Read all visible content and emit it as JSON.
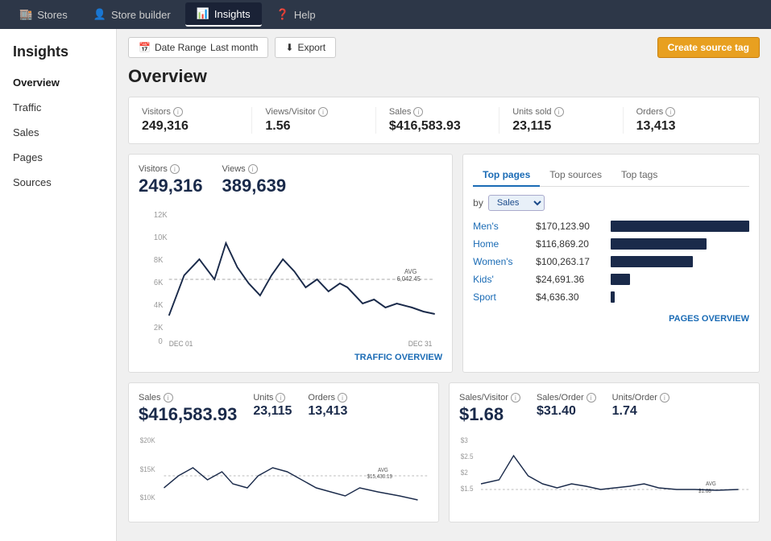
{
  "topnav": {
    "items": [
      {
        "id": "stores",
        "label": "Stores",
        "icon": "🏬",
        "active": false
      },
      {
        "id": "store-builder",
        "label": "Store builder",
        "icon": "👤",
        "active": false
      },
      {
        "id": "insights",
        "label": "Insights",
        "icon": "📊",
        "active": true
      },
      {
        "id": "help",
        "label": "Help",
        "icon": "❓",
        "active": false
      }
    ]
  },
  "sidebar": {
    "title": "Insights",
    "items": [
      {
        "id": "overview",
        "label": "Overview",
        "active": true
      },
      {
        "id": "traffic",
        "label": "Traffic",
        "active": false
      },
      {
        "id": "sales",
        "label": "Sales",
        "active": false
      },
      {
        "id": "pages",
        "label": "Pages",
        "active": false
      },
      {
        "id": "sources",
        "label": "Sources",
        "active": false
      }
    ]
  },
  "toolbar": {
    "date_range_label": "Date Range",
    "date_range_value": "Last month",
    "export_label": "Export",
    "create_source_tag_label": "Create source tag"
  },
  "overview": {
    "title": "Overview",
    "stats": [
      {
        "id": "visitors",
        "label": "Visitors",
        "value": "249,316"
      },
      {
        "id": "views-visitor",
        "label": "Views/Visitor",
        "value": "1.56"
      },
      {
        "id": "sales",
        "label": "Sales",
        "value": "$416,583.93"
      },
      {
        "id": "units-sold",
        "label": "Units sold",
        "value": "23,115"
      },
      {
        "id": "orders",
        "label": "Orders",
        "value": "13,413"
      }
    ]
  },
  "visitors_chart": {
    "visitors_label": "Visitors",
    "visitors_value": "249,316",
    "views_label": "Views",
    "views_value": "389,639",
    "avg_label": "AVG",
    "avg_value": "6,042.45",
    "x_start": "DEC 01",
    "x_end": "DEC 31",
    "link": "TRAFFIC OVERVIEW"
  },
  "top_pages": {
    "tabs": [
      "Top pages",
      "Top sources",
      "Top tags"
    ],
    "active_tab": "Top pages",
    "by_label": "by",
    "by_value": "Sales",
    "link": "PAGES OVERVIEW",
    "items": [
      {
        "name": "Men's",
        "value": "$170,123.90",
        "pct": 100
      },
      {
        "name": "Home",
        "value": "$116,869.20",
        "pct": 69
      },
      {
        "name": "Women's",
        "value": "$100,263.17",
        "pct": 59
      },
      {
        "name": "Kids'",
        "value": "$24,691.36",
        "pct": 14
      },
      {
        "name": "Sport",
        "value": "$4,636.30",
        "pct": 3
      }
    ]
  },
  "sales_chart": {
    "sales_label": "Sales",
    "sales_value": "$416,583.93",
    "units_label": "Units",
    "units_value": "23,115",
    "orders_label": "Orders",
    "orders_value": "13,413",
    "avg_label": "AVG",
    "avg_value": "$15,430.19",
    "y_labels": [
      "$20K",
      "$15K",
      "$10K"
    ]
  },
  "ratio_chart": {
    "sales_visitor_label": "Sales/Visitor",
    "sales_visitor_value": "$1.68",
    "sales_order_label": "Sales/Order",
    "sales_order_value": "$31.40",
    "units_order_label": "Units/Order",
    "units_order_value": "1.74",
    "avg_label": "AVG",
    "avg_value": "$1.68",
    "y_labels": [
      "$3",
      "$2.5",
      "$2",
      "$1.5"
    ]
  }
}
